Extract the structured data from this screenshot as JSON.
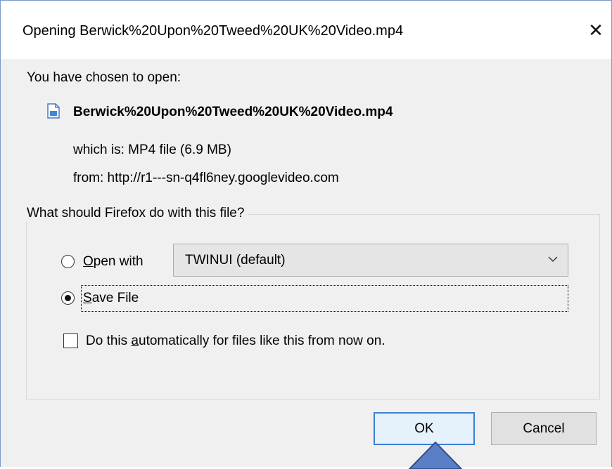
{
  "dialog": {
    "title": "Opening Berwick%20Upon%20Tweed%20UK%20Video.mp4",
    "close_glyph": "✕"
  },
  "info": {
    "chosen_label": "You have chosen to open:",
    "file_name": "Berwick%20Upon%20Tweed%20UK%20Video.mp4",
    "file_icon": "file-icon",
    "which_is": "which is:  MP4 file (6.9 MB)",
    "from": "from:  http://r1---sn-q4fl6ney.googlevideo.com"
  },
  "action_group": {
    "legend": "What should Firefox do with this file?",
    "open_with": {
      "label_prefix": "",
      "label_mnemonic": "O",
      "label_rest": "pen with",
      "selected": false
    },
    "app_select": {
      "value": "TWINUI (default)"
    },
    "save_file": {
      "label_mnemonic": "S",
      "label_rest": "ave File",
      "selected": true
    },
    "auto_checkbox": {
      "label_prefix": "Do this ",
      "label_mnemonic": "a",
      "label_rest": "utomatically for files like this from now on.",
      "checked": false
    }
  },
  "buttons": {
    "ok": "OK",
    "cancel": "Cancel"
  },
  "colors": {
    "dialog_bg": "#f0f0f0",
    "focus_border": "#3c7fd0",
    "annotation_arrow": "#5b7fc7"
  }
}
